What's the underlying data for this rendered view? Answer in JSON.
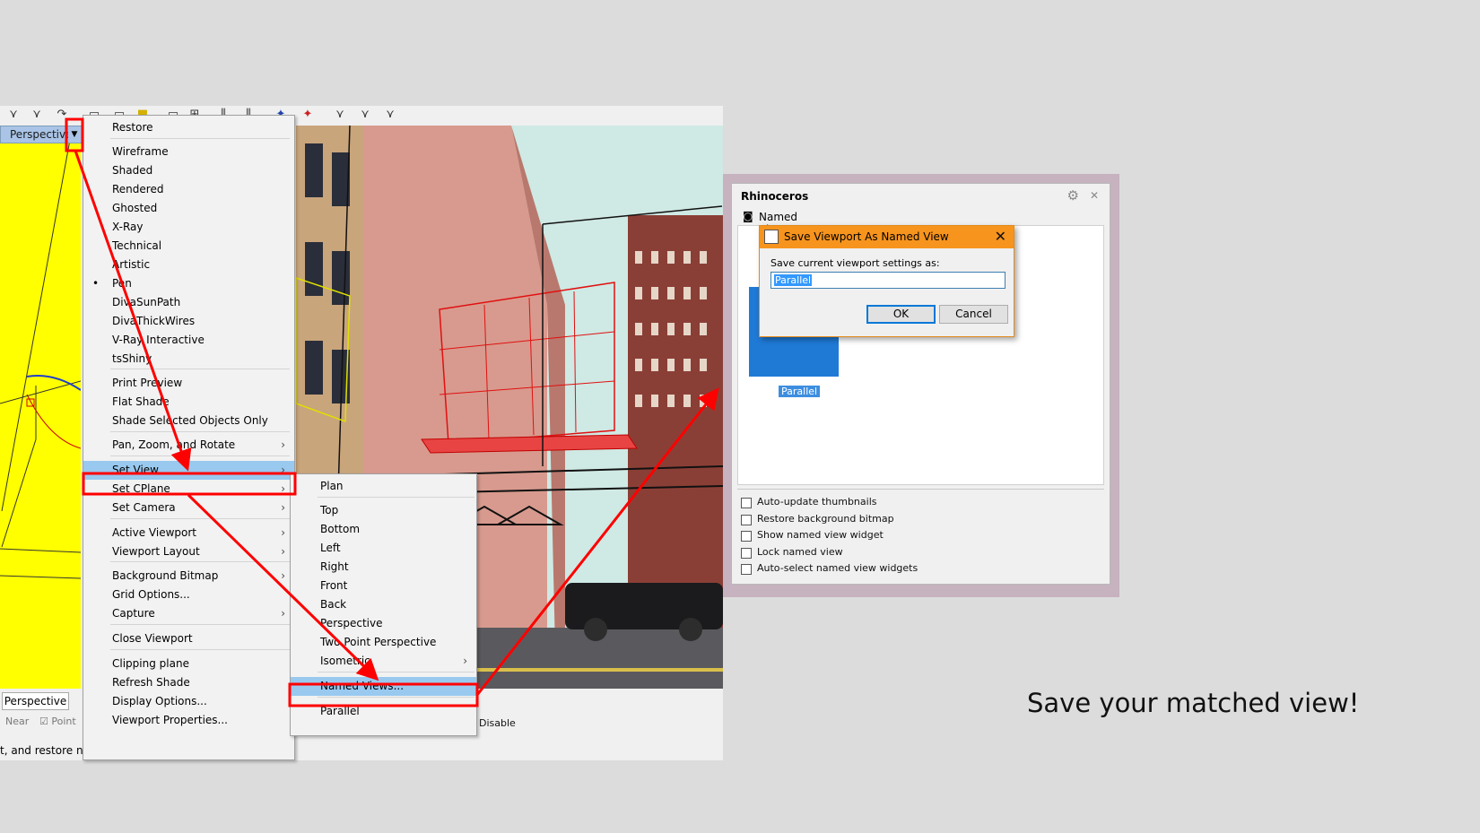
{
  "viewport": {
    "name": "Perspective",
    "bottom_tab": "Perspective"
  },
  "osnap": {
    "near": "Near",
    "point": "Point",
    "disable": "Disable"
  },
  "status_bar": {
    "text": "t, and restore nai"
  },
  "context_menu": {
    "items": [
      {
        "label": "Restore"
      },
      {
        "label": "Wireframe"
      },
      {
        "label": "Shaded"
      },
      {
        "label": "Rendered"
      },
      {
        "label": "Ghosted"
      },
      {
        "label": "X-Ray"
      },
      {
        "label": "Technical"
      },
      {
        "label": "Artistic"
      },
      {
        "label": "Pen",
        "checked_mark": "•"
      },
      {
        "label": "DivaSunPath"
      },
      {
        "label": "DivaThickWires"
      },
      {
        "label": "V-Ray Interactive"
      },
      {
        "label": "tsShiny"
      },
      {
        "label": "Print Preview"
      },
      {
        "label": "Flat Shade"
      },
      {
        "label": "Shade Selected Objects Only"
      },
      {
        "label": "Pan, Zoom, and Rotate",
        "arrow": "›"
      },
      {
        "label": "Set View",
        "arrow": "›"
      },
      {
        "label": "Set CPlane",
        "arrow": "›"
      },
      {
        "label": "Set Camera",
        "arrow": "›"
      },
      {
        "label": "Active Viewport",
        "arrow": "›"
      },
      {
        "label": "Viewport Layout",
        "arrow": "›"
      },
      {
        "label": "Background Bitmap",
        "arrow": "›"
      },
      {
        "label": "Grid Options..."
      },
      {
        "label": "Capture",
        "arrow": "›"
      },
      {
        "label": "Close Viewport"
      },
      {
        "label": "Clipping plane"
      },
      {
        "label": "Refresh Shade"
      },
      {
        "label": "Display Options..."
      },
      {
        "label": "Viewport Properties..."
      }
    ]
  },
  "set_view_submenu": {
    "items": [
      {
        "label": "Plan"
      },
      {
        "label": "Top"
      },
      {
        "label": "Bottom"
      },
      {
        "label": "Left"
      },
      {
        "label": "Right"
      },
      {
        "label": "Front"
      },
      {
        "label": "Back"
      },
      {
        "label": "Perspective"
      },
      {
        "label": "Two Point Perspective"
      },
      {
        "label": "Isometric",
        "arrow": "›"
      },
      {
        "label": "Named Views..."
      },
      {
        "label": "Parallel"
      }
    ]
  },
  "rhino_panel": {
    "title": "Rhinoceros",
    "tab": "Named Views",
    "thumbnail_label": "Parallel",
    "checkboxes": [
      "Auto-update thumbnails",
      "Restore background bitmap",
      "Show named view widget",
      "Lock named view",
      "Auto-select named view widgets"
    ]
  },
  "save_dialog": {
    "title": "Save Viewport As Named View",
    "prompt": "Save current viewport settings as:",
    "input_value": "Parallel",
    "ok_label": "OK",
    "cancel_label": "Cancel",
    "close_symbol": "✕"
  },
  "caption": "Save your matched view!",
  "colors": {
    "viewport_yellow": "#ffff00",
    "highlight": "#99c9ef",
    "dialog_orange": "#f7941d",
    "annotation_red": "#ff0000"
  }
}
